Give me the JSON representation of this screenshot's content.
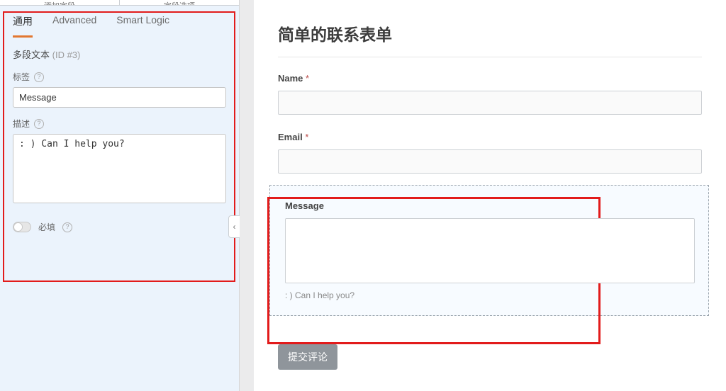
{
  "sidebar_top": {
    "left_label": "添加字段",
    "right_label": "字段选项"
  },
  "tabs": {
    "general": "通用",
    "advanced": "Advanced",
    "smart_logic": "Smart Logic"
  },
  "field_heading": {
    "type": "多段文本",
    "id_text": "(ID #3)"
  },
  "settings": {
    "label_label": "标签",
    "label_value": "Message",
    "desc_label": "描述",
    "desc_value": ": ) Can I help you?",
    "required_label": "必填"
  },
  "form": {
    "title": "简单的联系表单",
    "name_label": "Name",
    "email_label": "Email",
    "message_label": "Message",
    "message_desc": ": ) Can I help you?",
    "submit_label": "提交评论"
  },
  "symbols": {
    "asterisk": "*",
    "help": "?",
    "chevron_left": "‹"
  }
}
